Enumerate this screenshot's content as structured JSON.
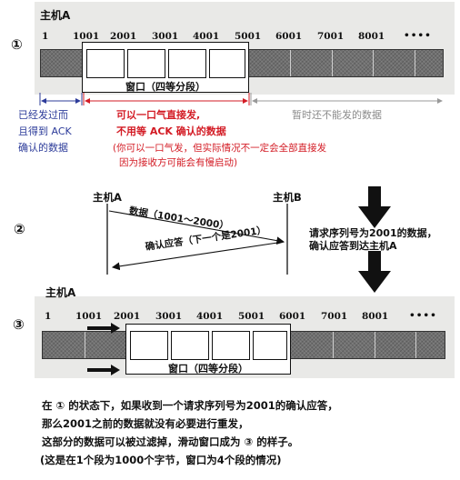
{
  "step1": {
    "number": "①",
    "host_label": "主机A",
    "ticks": [
      "1",
      "1001",
      "2001",
      "3001",
      "4001",
      "5001",
      "6001",
      "7001",
      "8001",
      "••••"
    ],
    "window_label": "窗口（四等分段）",
    "sent_acked": [
      "已经发过而",
      "且得到 ACK",
      "确认的数据"
    ],
    "sendable": [
      "可以一口气直接发,",
      "不用等 ACK 确认的数据"
    ],
    "sendable_note": [
      "(你可以一口气发，但实际情况不一定会全部直接发",
      "因为接收方可能会有慢启动)"
    ],
    "not_sendable": "暂时还不能发的数据"
  },
  "step2": {
    "number": "②",
    "host_a": "主机A",
    "host_b": "主机B",
    "data_msg": "数据（1001～2000）",
    "ack_msg": "确认应答（下一个是2001）",
    "explanation": [
      "请求序列号为2001的数据，",
      "确认应答到达主机A"
    ]
  },
  "step3": {
    "number": "③",
    "host_label": "主机A",
    "ticks": [
      "1",
      "1001",
      "2001",
      "3001",
      "4001",
      "5001",
      "6001",
      "7001",
      "8001",
      "••••"
    ],
    "window_label": "窗口（四等分段）"
  },
  "caption": [
    "在 ① 的状态下，如果收到一个请求序列号为2001的确认应答，",
    "那么2001之前的数据就没有必要进行重发，",
    "这部分的数据可以被过滤掉，滑动窗口成为 ③ 的样子。",
    "(这是在1个段为1000个字节，窗口为4个段的情况)"
  ],
  "colors": {
    "blue_text": "#2d3c9a",
    "red_text": "#d31b24",
    "grey_text": "#8b8b8b",
    "panel_bg": "#e9e9e7",
    "data_bar": "#707070"
  }
}
